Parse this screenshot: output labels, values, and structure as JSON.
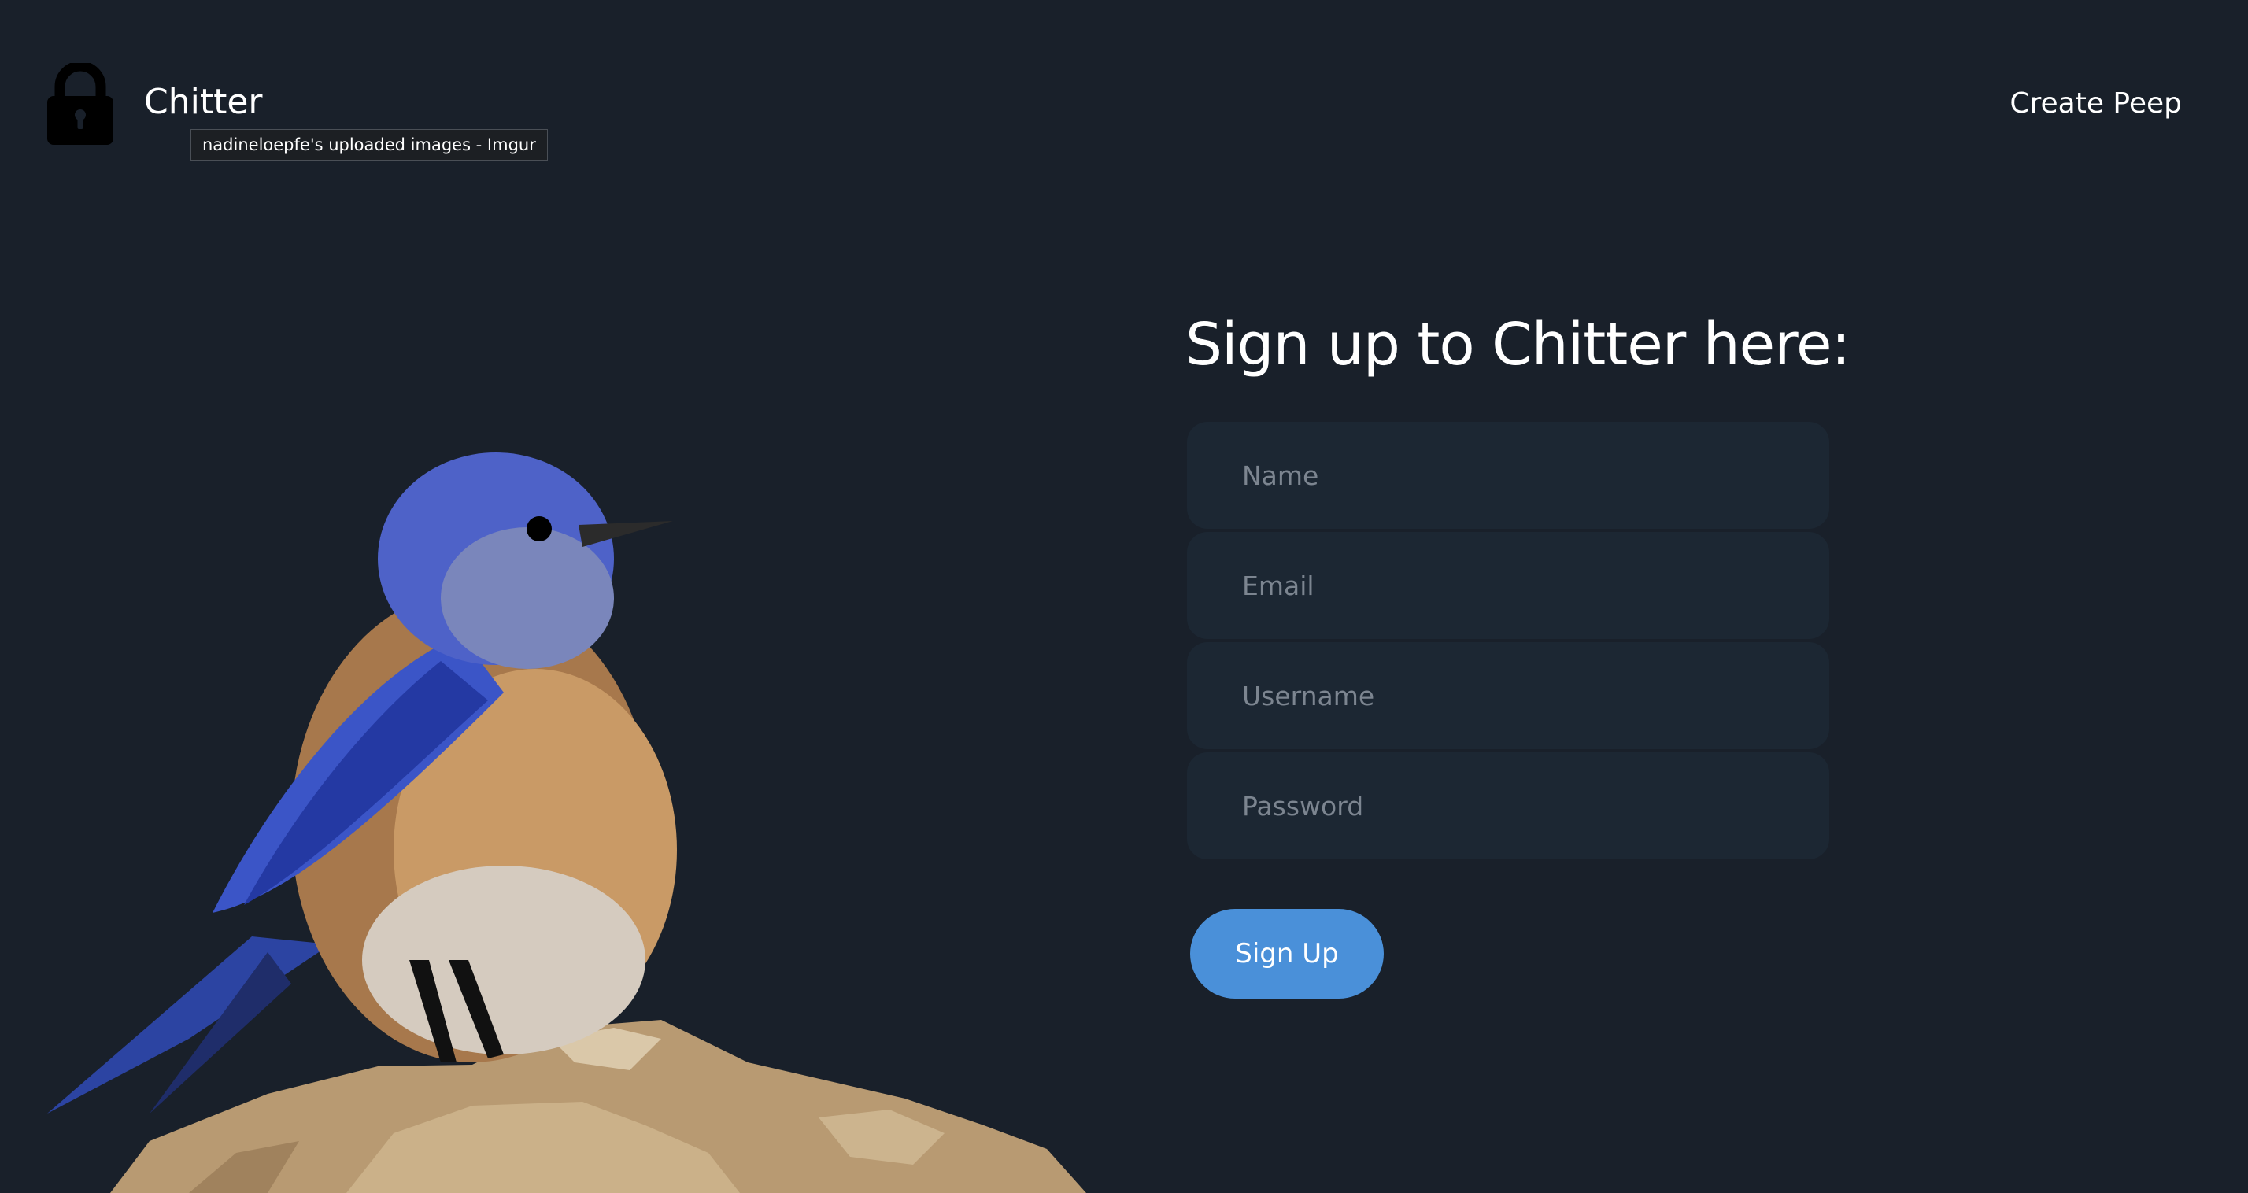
{
  "header": {
    "brand": "Chitter",
    "logo_icon": "lock-icon",
    "tooltip": "nadineloepfe's uploaded images - Imgur",
    "nav_link": "Create Peep"
  },
  "hero": {
    "image": "bluebird-on-rock"
  },
  "signup_form": {
    "title": "Sign up to Chitter here:",
    "name_placeholder": "Name",
    "email_placeholder": "Email",
    "username_placeholder": "Username",
    "password_placeholder": "Password",
    "submit_label": "Sign Up"
  },
  "colors": {
    "background": "#19202a",
    "field_background": "#1c2733",
    "button": "#4a90d9",
    "text": "#ffffff",
    "placeholder": "#7c8590"
  }
}
